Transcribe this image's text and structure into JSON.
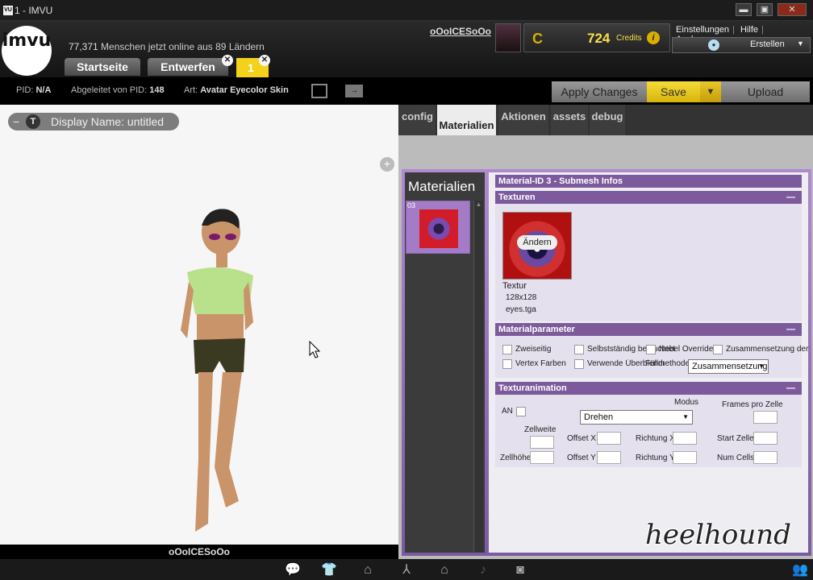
{
  "window": {
    "title": "1 - IMVU",
    "app_icon": "imvu-icon",
    "min": "▬",
    "max": "▣",
    "close": "✕"
  },
  "header": {
    "logo": "imvu",
    "online_count": "77,371",
    "online_text": "Menschen jetzt online aus 89 Ländern",
    "tabs": [
      "Startseite",
      "Entwerfen",
      "1"
    ],
    "username": "oOoICESoOo",
    "credits_amount": "724",
    "credits_label": "Credits",
    "credits_icon": "C",
    "info_icon": "i",
    "links": [
      "Einstellungen",
      "Hilfe",
      "Ausloggen"
    ],
    "create_label": "Erstellen"
  },
  "inforow": {
    "pid_label": "PID:",
    "pid_value": "N/A",
    "derived_label": "Abgeleitet von PID:",
    "derived_value": "148",
    "type_label": "Art:",
    "type_value": "Avatar Eyecolor Skin",
    "buttons": [
      "Apply Changes",
      "Save",
      "▼",
      "Upload"
    ]
  },
  "viewer": {
    "display_name": "Display Name: untitled",
    "footer_name": "oOoICESoOo"
  },
  "tabs": [
    "config",
    "Materialien",
    "Aktionen",
    "assets",
    "debug"
  ],
  "materials": {
    "title": "Materialien",
    "item_number": "03",
    "header": "Material-ID 3 - Submesh Infos",
    "textures": {
      "title": "Texturen",
      "change_button": "Ändern",
      "label": "Textur",
      "size": "128x128",
      "file": "eyes.tga"
    },
    "params": {
      "title": "Materialparameter",
      "options": [
        "Zweiseitig",
        "Selbstständig beleuchtet",
        "Nebel Override",
        "Zusammensetzung der",
        "Vertex Farben",
        "Verwende Überblendmethode"
      ],
      "blend_label": "Füllmethode",
      "blend_value": "Zusammensetzung"
    },
    "anim": {
      "title": "Texturanimation",
      "on_label": "AN",
      "mode_label": "Modus",
      "mode_value": "Drehen",
      "frames_label": "Frames pro Zelle",
      "cell_width": "Zellweite",
      "cell_height": "Zellhöhe",
      "offset_x": "Offset X",
      "offset_y": "Offset Y",
      "dir_x": "Richtung X",
      "dir_y": "Richtung Y",
      "start_cell": "Start Zelle",
      "num_cells": "Num Cells"
    }
  },
  "watermark": "heelhound",
  "bottom_icons": [
    "chat-icon",
    "shirt-icon",
    "hanger-icon",
    "pose-icon",
    "home-icon",
    "music-icon",
    "camera-icon",
    "people-icon"
  ]
}
